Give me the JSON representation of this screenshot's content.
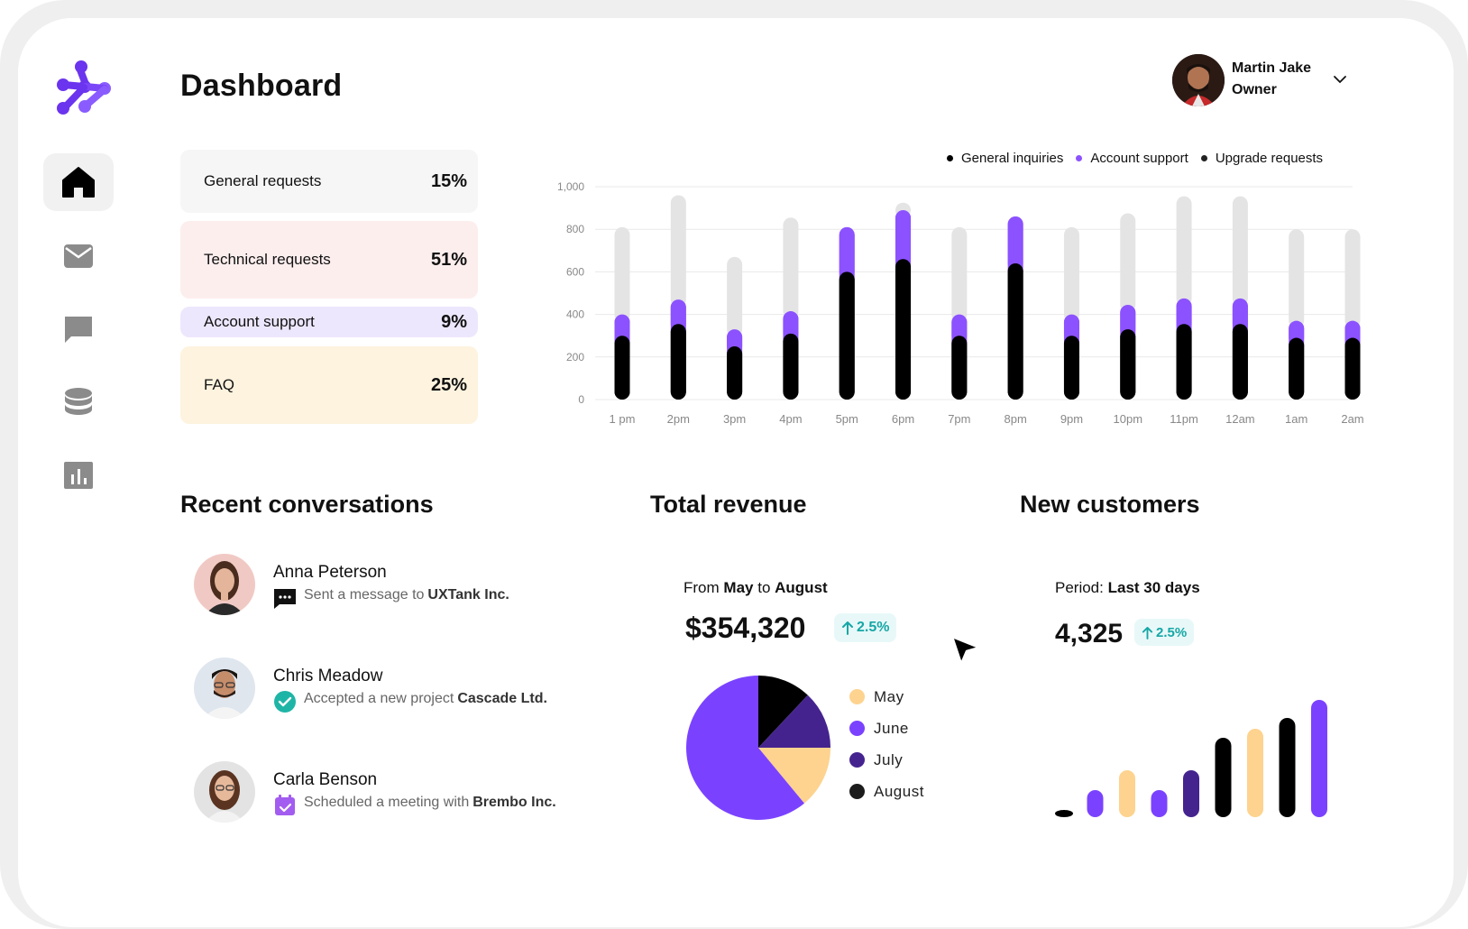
{
  "page": {
    "title": "Dashboard"
  },
  "sidebar": {
    "items": [
      {
        "icon": "home-icon",
        "active": true
      },
      {
        "icon": "mail-icon",
        "active": false
      },
      {
        "icon": "chat-icon",
        "active": false
      },
      {
        "icon": "database-icon",
        "active": false
      },
      {
        "icon": "chart-icon",
        "active": false
      }
    ]
  },
  "user": {
    "name": "Martin Jake",
    "role": "Owner"
  },
  "requests": [
    {
      "label": "General requests",
      "value": "15%",
      "color": "#f6f6f6"
    },
    {
      "label": "Technical requests",
      "value": "51%",
      "color": "#fdeeee"
    },
    {
      "label": "Account support",
      "value": "9%",
      "color": "#ede7fd"
    },
    {
      "label": "FAQ",
      "value": "25%",
      "color": "#fdf3de"
    }
  ],
  "colors": {
    "black": "#000000",
    "purple": "#8c52ff",
    "bright_purple": "#7a42ff",
    "dark_purple": "#45238f",
    "peach": "#fdd38f",
    "gray_bar": "#e4e4e4",
    "teal": "#17a6a6"
  },
  "chart_data": [
    {
      "type": "bar",
      "stacked": true,
      "categories": [
        "1 pm",
        "2pm",
        "3pm",
        "4pm",
        "5pm",
        "6pm",
        "7pm",
        "8pm",
        "9pm",
        "10pm",
        "11pm",
        "12am",
        "1am",
        "2am"
      ],
      "series": [
        {
          "name": "General inquiries",
          "color": "#000000",
          "values": [
            300,
            355,
            250,
            310,
            600,
            660,
            300,
            640,
            300,
            330,
            355,
            355,
            290,
            290
          ]
        },
        {
          "name": "Account support",
          "color": "#8c52ff",
          "values": [
            100,
            115,
            80,
            105,
            210,
            230,
            100,
            220,
            100,
            115,
            120,
            120,
            80,
            80
          ]
        },
        {
          "name": "Upgrade requests",
          "color": "#e4e4e4",
          "values": [
            410,
            490,
            340,
            440,
            0,
            35,
            410,
            0,
            410,
            430,
            480,
            480,
            430,
            430
          ]
        }
      ],
      "yticks": [
        "1,000",
        "800",
        "600",
        "400",
        "200",
        "0"
      ],
      "ylim": [
        0,
        1000
      ],
      "grid": true,
      "legend": "top-right"
    },
    {
      "type": "pie",
      "labels": [
        "May",
        "June",
        "July",
        "August"
      ],
      "colors": [
        "#fdd38f",
        "#7a42ff",
        "#45238f",
        "#000000"
      ],
      "values": [
        14,
        61,
        13,
        12
      ]
    },
    {
      "type": "bar",
      "values": [
        8,
        30,
        52,
        30,
        52,
        88,
        98,
        110,
        130
      ],
      "colors": [
        "#000000",
        "#7a42ff",
        "#fdd38f",
        "#7a42ff",
        "#45238f",
        "#000000",
        "#fdd38f",
        "#000000",
        "#7a42ff"
      ]
    }
  ],
  "sections": {
    "conversations": "Recent conversations",
    "revenue": "Total revenue",
    "customers": "New customers"
  },
  "conversations": [
    {
      "name": "Anna Peterson",
      "action": "Sent a message to",
      "target": "UXTank Inc.",
      "icon": "message-icon"
    },
    {
      "name": "Chris Meadow",
      "action": "Accepted a new project",
      "target": "Cascade Ltd.",
      "icon": "check-circle-icon"
    },
    {
      "name": "Carla Benson",
      "action": "Scheduled a meeting with",
      "target": "Brembo Inc.",
      "icon": "calendar-icon"
    }
  ],
  "revenue": {
    "period_prefix": "From",
    "period_from": "May",
    "period_mid": "to",
    "period_to": "August",
    "value": "$354,320",
    "change": "2.5%"
  },
  "customers": {
    "period_prefix": "Period:",
    "period": "Last 30 days",
    "value": "4,325",
    "change": "2.5%"
  }
}
